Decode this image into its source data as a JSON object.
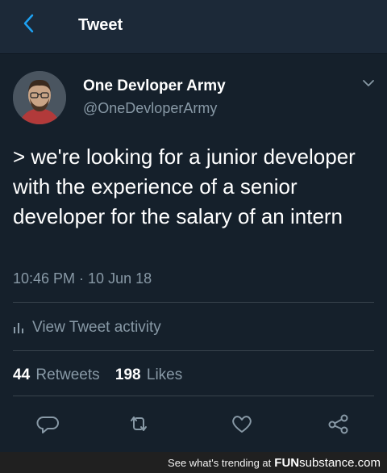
{
  "header": {
    "title": "Tweet"
  },
  "tweet": {
    "display_name": "One Devloper Army",
    "handle": "@OneDevloperArmy",
    "text": "> we're looking for a junior developer with the experience of a senior developer for the salary of an intern",
    "timestamp": "10:46 PM · 10 Jun 18",
    "activity_label": "View Tweet activity",
    "retweets_count": "44",
    "retweets_label": "Retweets",
    "likes_count": "198",
    "likes_label": "Likes"
  },
  "actions": [
    "reply-icon",
    "retweet-icon",
    "like-icon",
    "share-icon"
  ],
  "footer": {
    "text": "See what's trending at",
    "brand_bold": "FUN",
    "brand_rest": "substance.com"
  },
  "colors": {
    "background": "#15202b",
    "header": "#1c2938",
    "accent": "#1da1f2",
    "secondary_text": "#8899a6"
  }
}
